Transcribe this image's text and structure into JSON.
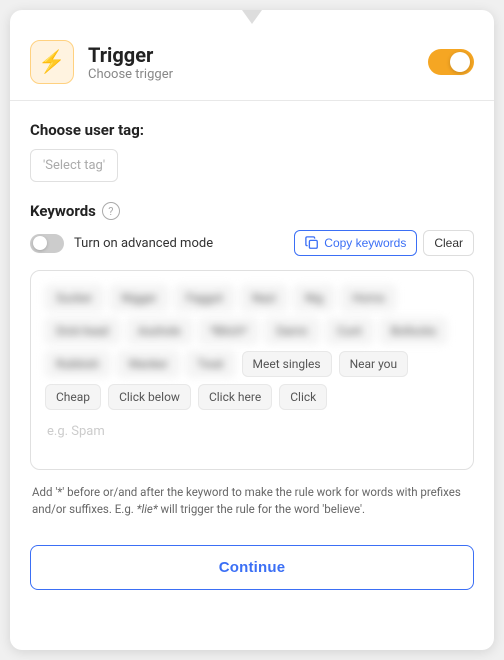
{
  "header": {
    "title": "Trigger",
    "subtitle": "Choose trigger",
    "toggle_on": true
  },
  "user_tag": {
    "label": "Choose user tag:",
    "placeholder": "'Select tag'"
  },
  "keywords": {
    "title": "Keywords",
    "advanced_mode_label": "Turn on advanced mode",
    "copy_keywords_label": "Copy keywords",
    "clear_label": "Clear",
    "tags_blurred": [
      "Sucker",
      "Nigger",
      "Faggot",
      "Nazi",
      "Nig",
      "Homo",
      "Dick-head",
      "Asshole",
      "*Bitch*",
      "Damn",
      "Cunt",
      "Bollocks",
      "Rubbish",
      "Wanker",
      "Twat"
    ],
    "tags_normal": [
      "Meet singles",
      "Near you",
      "Cheap",
      "Click below",
      "Click here",
      "Click"
    ],
    "placeholder": "e.g. Spam"
  },
  "info": {
    "text": "Add '*' before or/and after the keyword to make the rule work for words with prefixes and/or suffixes. E.g. *lie* will trigger the rule for the word 'believe'."
  },
  "footer": {
    "continue_label": "Continue"
  }
}
